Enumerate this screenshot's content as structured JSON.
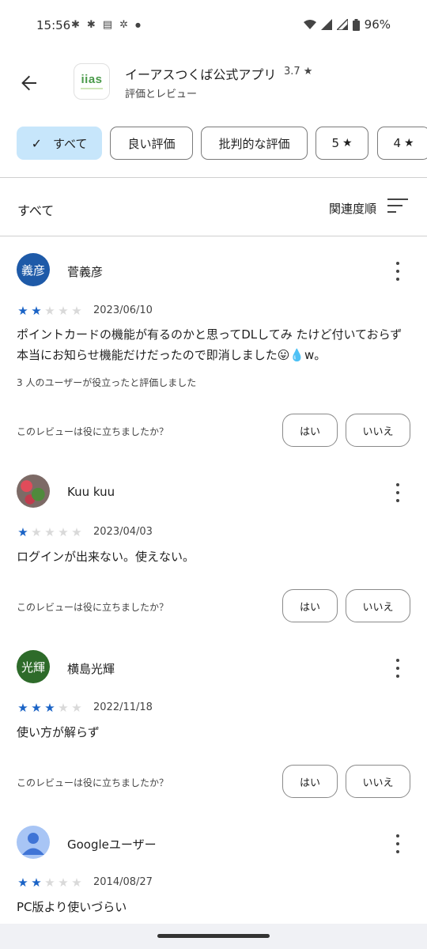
{
  "status_bar": {
    "time": "15:56",
    "notification_icons": [
      "slack-icon",
      "slack-icon",
      "message-icon",
      "slack-outline-icon",
      "dot-icon"
    ],
    "battery": "96%"
  },
  "header": {
    "app_icon_text": "iias",
    "app_name": "イーアスつくば公式アプリ",
    "rating": "3.7 ★",
    "subtitle": "評価とレビュー"
  },
  "filters": [
    {
      "label": "すべて",
      "selected": true
    },
    {
      "label": "良い評価",
      "selected": false
    },
    {
      "label": "批判的な評価",
      "selected": false
    },
    {
      "label": "5",
      "selected": false,
      "star": "★"
    },
    {
      "label": "4",
      "selected": false,
      "star": "★"
    }
  ],
  "sort": {
    "title": "すべて",
    "order_label": "関連度順"
  },
  "reviews": [
    {
      "avatar_text": "義彦",
      "avatar_color": "#1e5aa8",
      "name": "菅義彦",
      "stars": 2,
      "date": "2023/06/10",
      "body": "ポイントカードの機能が有るのかと思ってDLしてみ たけど付いておらず本当にお知らせ機能だけだったので即消しました😛💧w。",
      "helpful": "3 人のユーザーが役立ったと評価しました",
      "question": "このレビューは役に立ちましたか？",
      "yes": "はい",
      "no": "いいえ"
    },
    {
      "avatar_text": "",
      "avatar_color": "#7d6a66",
      "name": "Kuu kuu",
      "stars": 1,
      "date": "2023/04/03",
      "body": "ログインが出来ない。使えない。",
      "helpful": "",
      "question": "このレビューは役に立ちましたか？",
      "yes": "はい",
      "no": "いいえ"
    },
    {
      "avatar_text": "光輝",
      "avatar_color": "#2e6b2a",
      "name": "横島光輝",
      "stars": 3,
      "date": "2022/11/18",
      "body": "使い方が解らず",
      "helpful": "",
      "question": "このレビューは役に立ちましたか？",
      "yes": "はい",
      "no": "いいえ"
    },
    {
      "avatar_text": "",
      "avatar_color": "#a8c5f5",
      "name": "Googleユーザー",
      "stars": 2,
      "date": "2014/08/27",
      "body": "PC版より使いづらい",
      "helpful": "",
      "question": "",
      "yes": "",
      "no": ""
    }
  ],
  "colors": {
    "star_on": "#1a63c6",
    "star_off": "#d9d9d9",
    "chip_selected": "#c7e6fb"
  }
}
